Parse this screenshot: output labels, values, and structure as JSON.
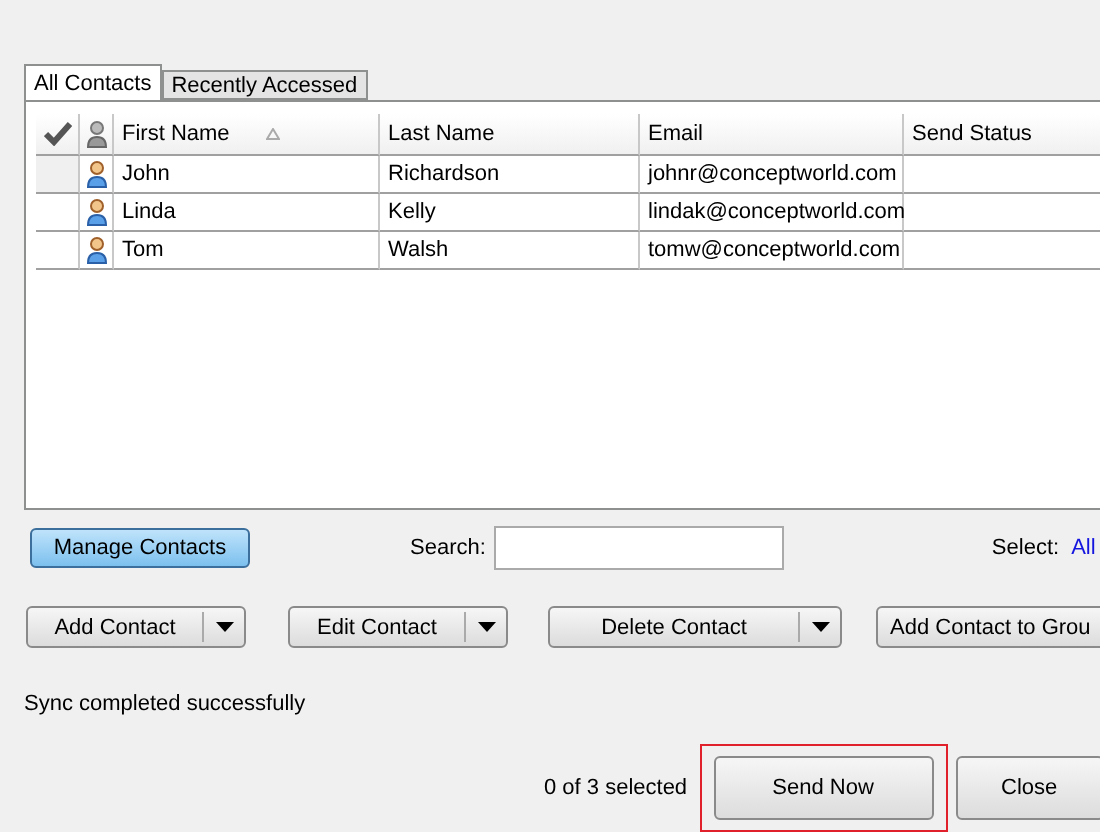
{
  "tabs": [
    {
      "label": "All Contacts",
      "selected": true
    },
    {
      "label": "Recently Accessed",
      "selected": false
    }
  ],
  "table": {
    "columns": [
      {
        "label": "First Name",
        "sorted": true
      },
      {
        "label": "Last Name",
        "sorted": false
      },
      {
        "label": "Email",
        "sorted": false
      },
      {
        "label": "Send Status",
        "sorted": false
      }
    ],
    "rows": [
      {
        "first_name": "John",
        "last_name": "Richardson",
        "email": "johnr@conceptworld.com",
        "send_status": "",
        "checked": false
      },
      {
        "first_name": "Linda",
        "last_name": "Kelly",
        "email": "lindak@conceptworld.com",
        "send_status": "",
        "checked": false
      },
      {
        "first_name": "Tom",
        "last_name": "Walsh",
        "email": "tomw@conceptworld.com",
        "send_status": "",
        "checked": false
      }
    ]
  },
  "manage_button": "Manage Contacts",
  "search": {
    "label": "Search:"
  },
  "select": {
    "label": "Select:",
    "link": "All"
  },
  "action_buttons": [
    "Add Contact",
    "Edit Contact",
    "Delete Contact",
    "Add Contact to Grou"
  ],
  "status": "Sync completed successfully",
  "selection_count": "0 of 3 selected",
  "send_button": "Send Now",
  "close_button": "Close"
}
